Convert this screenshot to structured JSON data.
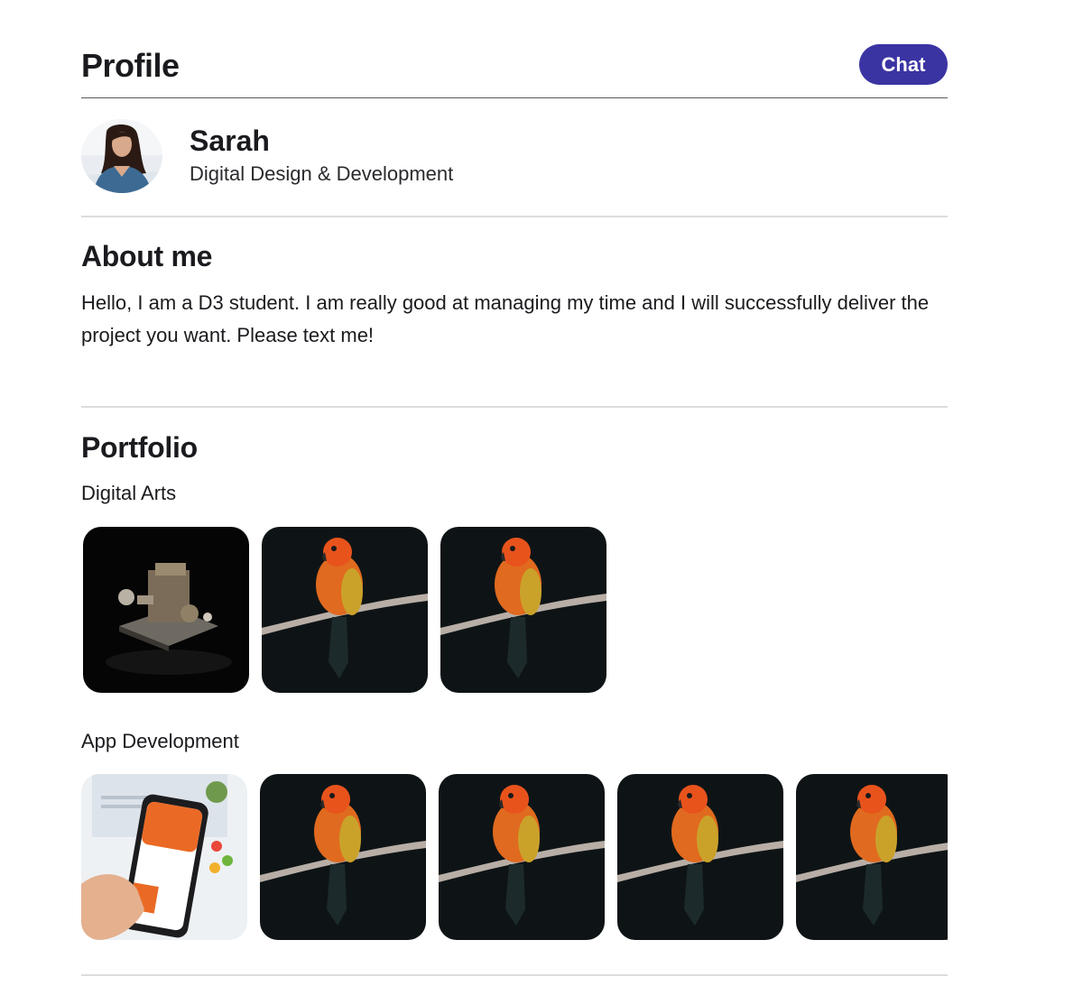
{
  "header": {
    "title": "Profile",
    "chat_label": "Chat",
    "chat_color": "#3a34a3"
  },
  "profile": {
    "name": "Sarah",
    "role": "Digital Design & Development",
    "avatar_icon": "avatar-photo"
  },
  "about": {
    "title": "About me",
    "text": "Hello, I am a D3 student. I am really good at managing my time and I will successfully deliver the project you want. Please text me!"
  },
  "portfolio": {
    "title": "Portfolio",
    "categories": [
      {
        "title": "Digital Arts",
        "items": [
          "3d-render-image",
          "parrot-image",
          "parrot-image"
        ]
      },
      {
        "title": "App Development",
        "items": [
          "phone-app-image",
          "parrot-image",
          "parrot-image",
          "parrot-image",
          "parrot-image"
        ]
      }
    ]
  }
}
